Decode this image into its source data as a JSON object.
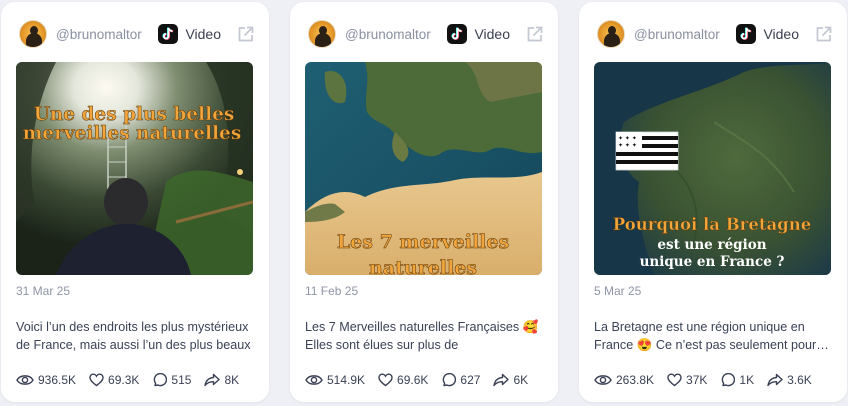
{
  "cards": [
    {
      "handle": "@brunomaltor",
      "platform_label": "Video",
      "platform_icon": "tiktok-icon",
      "thumb_caption_line1": "Une des plus belles",
      "thumb_caption_line2": "merveilles naturelles",
      "date": "31 Mar 25",
      "description": "Voici l’un des endroits les plus mystérieux de France, mais aussi l’un des plus beaux",
      "stats": {
        "views": "936.5K",
        "likes": "69.3K",
        "comments": "515",
        "shares": "8K"
      }
    },
    {
      "handle": "@brunomaltor",
      "platform_label": "Video",
      "platform_icon": "tiktok-icon",
      "thumb_caption_line1": "Les 7 merveilles",
      "thumb_caption_line2": "naturelles",
      "date": "11 Feb 25",
      "description": "Les 7 Merveilles naturelles Françaises 🥰 Elles sont élues sur plus de",
      "stats": {
        "views": "514.9K",
        "likes": "69.6K",
        "comments": "627",
        "shares": "6K"
      }
    },
    {
      "handle": "@brunomaltor",
      "platform_label": "Video",
      "platform_icon": "tiktok-icon",
      "thumb_caption_line1": "Pourquoi la Bretagne",
      "thumb_caption_line2": "est une région",
      "thumb_caption_line3": "unique en France ?",
      "date": "5 Mar 25",
      "description": "La Bretagne est une région unique en France 😍 Ce n’est pas seulement pour ses paysages",
      "stats": {
        "views": "263.8K",
        "likes": "37K",
        "comments": "1K",
        "shares": "3.6K"
      }
    }
  ],
  "colors": {
    "caption_orange": "#f2a53a",
    "caption_white": "#ffffff",
    "muted_text": "#8a90a2",
    "body_text": "#3c4256"
  }
}
